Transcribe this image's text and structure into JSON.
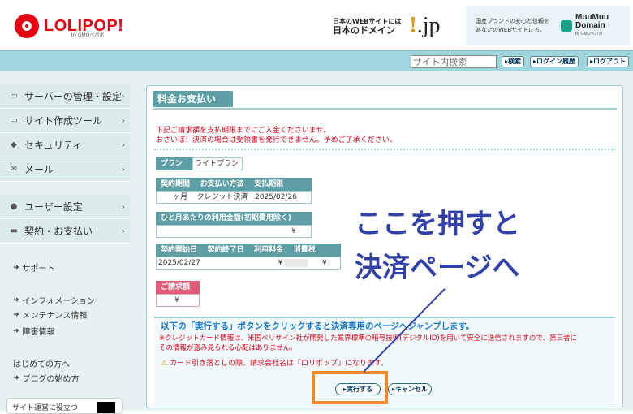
{
  "header": {
    "logo_text": "LOLIPOP!",
    "logo_sub": "by GMOペパボ",
    "ad_jp_line1": "日本のWEBサイトには",
    "ad_jp_line2": "日本のドメイン",
    "ad_jp_logo": ".jp",
    "ad_mm_line1": "国産ブランドの安心と信頼を",
    "ad_mm_line2": "あなたのWEBサイトにも。",
    "ad_mm_name1": "MuuMuu",
    "ad_mm_name2": "Domain",
    "ad_mm_by": "by GMOペパボ"
  },
  "navbar": {
    "search_placeholder": "サイト内検索",
    "search_button": "▸検索",
    "login_history": "▸ログイン履歴",
    "logout": "▸ログアウト"
  },
  "sidebar": {
    "menu": [
      {
        "label": "サーバーの管理・設定",
        "icon": "server-icon"
      },
      {
        "label": "サイト作成ツール",
        "icon": "laptop-icon"
      },
      {
        "label": "セキュリティ",
        "icon": "shield-icon"
      },
      {
        "label": "メール",
        "icon": "mail-icon"
      },
      {
        "label": "ユーザー設定",
        "icon": "user-icon"
      },
      {
        "label": "契約・お支払い",
        "icon": "card-icon"
      }
    ],
    "links": [
      "サポート",
      "インフォメーション",
      "メンテナンス情報",
      "障害情報",
      "はじめての方へ",
      "ブログの始め方"
    ],
    "card_text": "サイト運営に役立つ"
  },
  "main": {
    "title": "料金お支払い",
    "notice1": "下記ご請求額を支払期限までにご入金くださいませ。",
    "notice2": "おさいぽ！決済の場合は受領書を発行できません。予めご了承ください。",
    "plan_label": "プラン",
    "plan_value": "ライトプラン",
    "contract_term_label": "契約期間",
    "payment_method_label": "お支払い方法",
    "due_date_label": "支払期限",
    "contract_term_value": "ヶ月",
    "payment_method_value": "クレジット決済",
    "due_date_value": "2025/02/26",
    "monthly_fee_label": "ひと月あたりの利用金額(初期費用除く)",
    "monthly_fee_value": "¥",
    "start_date_label": "契約開始日",
    "end_date_label": "契約終了日",
    "usage_fee_label": "利用料金",
    "tax_label": "消費税",
    "start_date_value": "2025/02/27",
    "usage_fee_value": "¥",
    "tax_value": "¥",
    "charge_label": "ご請求額",
    "charge_value": "¥",
    "info_main": "以下の「実行する」ボタンをクリックすると決済専用のページへジャンプします。",
    "info_red1": "※クレジットカード情報は、米国ベリサイン社が開発した業界標準の暗号技術(デジタルID)を用いて安全に送信されますので、第三者に",
    "info_red2": "その情報が盗み見られる心配はありません。",
    "warn_text": "カード引き落としの際、請求会社名は『ロリポップ』になります。",
    "exec_button": "▸実行する",
    "cancel_button": "▸キャンセル"
  },
  "annotation": {
    "line1": "ここを押すと",
    "line2": "決済ページへ",
    "color": "#3241a8",
    "highlight_color": "#f0892a"
  }
}
